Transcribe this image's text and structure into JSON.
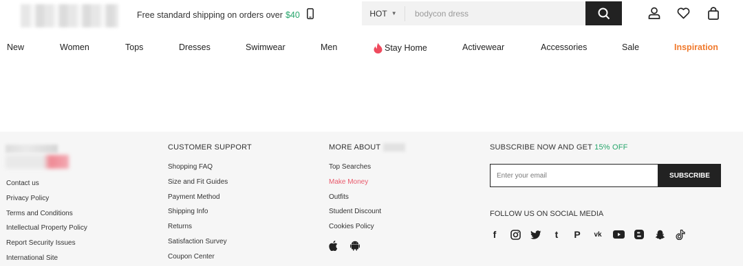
{
  "header": {
    "shipping_text": "Free standard shipping on orders over ",
    "shipping_amount": "$40",
    "search": {
      "category": "HOT",
      "placeholder": "bodycon dress"
    }
  },
  "nav": {
    "items": [
      {
        "label": "New"
      },
      {
        "label": "Women"
      },
      {
        "label": "Tops"
      },
      {
        "label": "Dresses"
      },
      {
        "label": "Swimwear"
      },
      {
        "label": "Men"
      },
      {
        "label": "Stay Home",
        "icon": "flame-icon"
      },
      {
        "label": "Activewear"
      },
      {
        "label": "Accessories"
      },
      {
        "label": "Sale"
      },
      {
        "label": "Inspiration",
        "color": "#f0792c"
      }
    ]
  },
  "footer": {
    "company_links": [
      "Contact us",
      "Privacy Policy",
      "Terms and Conditions",
      "Intellectual Property Policy",
      "Report Security Issues",
      "International Site"
    ],
    "support": {
      "title": "CUSTOMER SUPPORT",
      "links": [
        "Shopping FAQ",
        "Size and Fit Guides",
        "Payment Method",
        "Shipping Info",
        "Returns",
        "Satisfaction Survey",
        "Coupon Center"
      ]
    },
    "about": {
      "title": "MORE ABOUT",
      "links": [
        "Top Searches",
        "Make Money",
        "Outfits",
        "Student Discount",
        "Cookies Policy"
      ],
      "highlight_color": "#e9596b"
    },
    "subscribe": {
      "title_prefix": "SUBSCRIBE NOW AND GET ",
      "title_highlight": "15% OFF",
      "email_placeholder": "Enter your email",
      "button_label": "SUBSCRIBE"
    },
    "follow_title": "FOLLOW US ON SOCIAL MEDIA",
    "social_icons": [
      "facebook-icon",
      "instagram-icon",
      "twitter-icon",
      "tumblr-icon",
      "pinterest-icon",
      "vk-icon",
      "youtube-icon",
      "blogger-icon",
      "snapchat-icon",
      "tiktok-icon"
    ]
  },
  "colors": {
    "accent_green": "#25a56a",
    "inspiration_orange": "#f0792c",
    "footer_bg": "#f6f6f6"
  }
}
